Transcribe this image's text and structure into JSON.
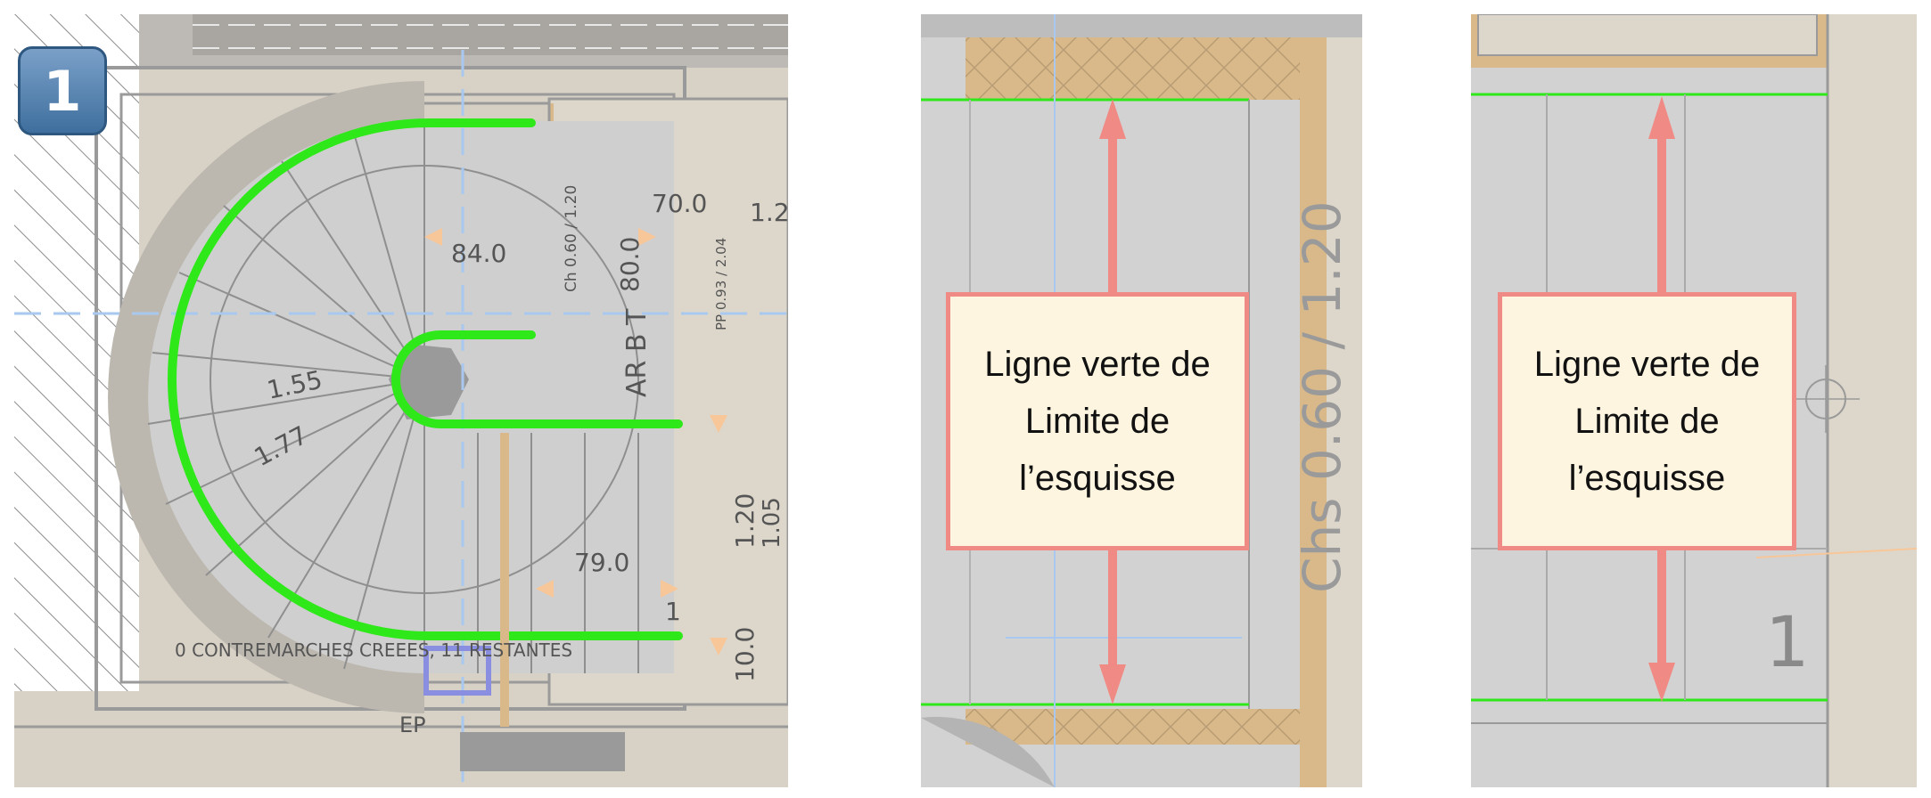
{
  "badge": {
    "number": "1"
  },
  "panel_1": {
    "dimension_labels": {
      "d_84": "84.0",
      "d_80": "80.0",
      "d_70": "70.0",
      "d_12": "1.2",
      "d_155": "1.55",
      "d_177": "1.77",
      "d_79": "79.0",
      "d_120": "1.20",
      "d_105": "1.05",
      "d_10": "10.0",
      "step_1": "1",
      "ar_bt": "AR  B  T",
      "door_1": "Ch 0.60 / 1.20",
      "door_2": "PP 0.93 / 2.04",
      "contremarches": "0 CONTREMARCHES CREEES, 11 RESTANTES",
      "ep": "EP"
    }
  },
  "panel_2": {
    "callout": "Ligne verte de\nLimite de\nl’esquisse",
    "wall_text": "Chs 0.60 / 1.20"
  },
  "panel_3": {
    "callout": "Ligne verte de\nLimite de\nl’esquisse",
    "step_number": "1"
  },
  "colors": {
    "sketch_limit_green": "#2ee81a",
    "arrow_red": "#f08a84",
    "callout_bg": "#fdf5e0",
    "wall_tan": "#d9b98a",
    "floor_grey": "#d2d2d2"
  }
}
